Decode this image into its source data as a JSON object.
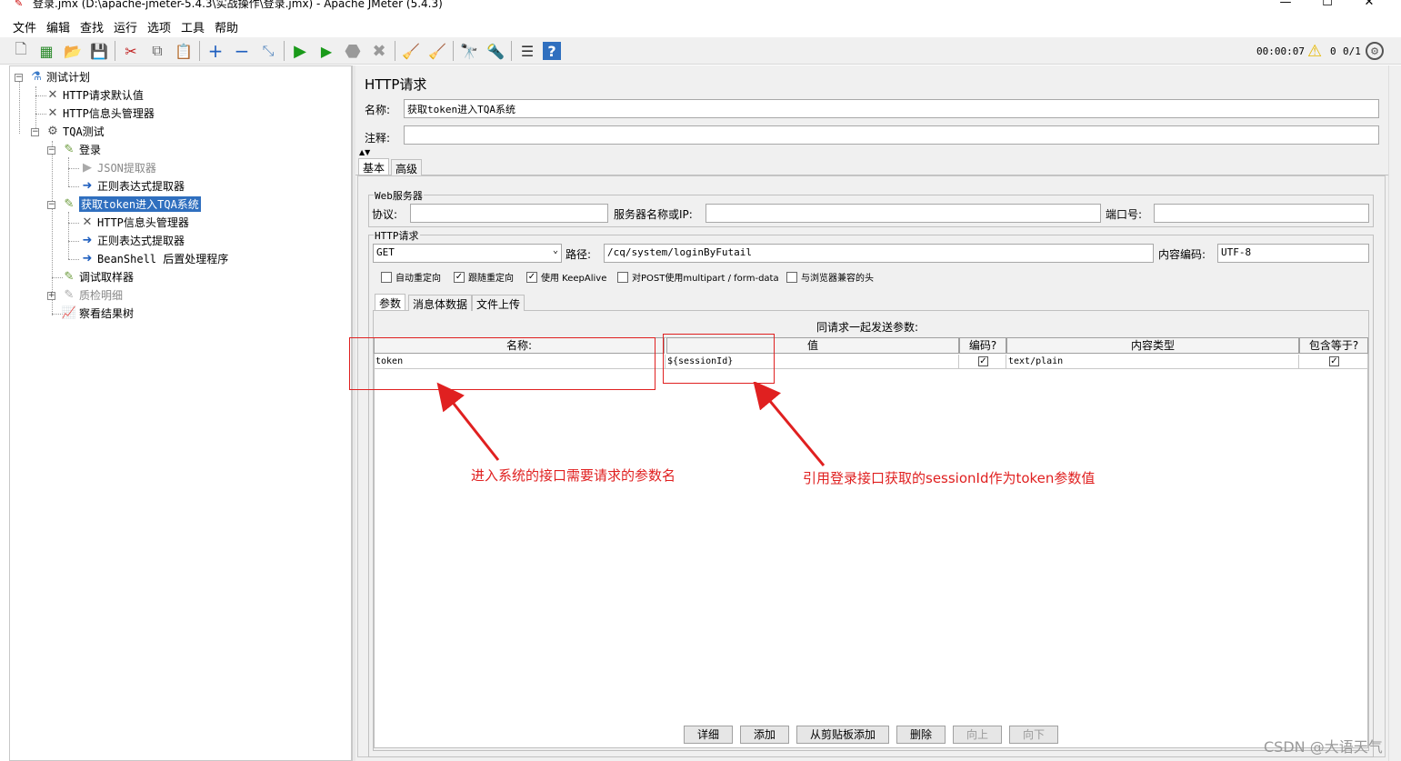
{
  "window": {
    "title": "登录.jmx (D:\\apache-jmeter-5.4.3\\实战操作\\登录.jmx) - Apache JMeter (5.4.3)",
    "minimize": "—",
    "maximize": "☐",
    "close": "✕"
  },
  "menu": [
    "文件",
    "编辑",
    "查找",
    "运行",
    "选项",
    "工具",
    "帮助"
  ],
  "toolbar": {
    "timer": "00:00:07",
    "error_count": "0",
    "threads": "0/1"
  },
  "tree": {
    "test_plan": "测试计划",
    "http_defaults": "HTTP请求默认值",
    "http_header_mgr": "HTTP信息头管理器",
    "thread_group": "TQA测试",
    "login": "登录",
    "json_extractor": "JSON提取器",
    "regex_extractor": "正则表达式提取器",
    "get_token": "获取token进入TQA系统",
    "header_mgr2": "HTTP信息头管理器",
    "regex_extractor2": "正则表达式提取器",
    "beanshell": "BeanShell 后置处理程序",
    "debug_sampler": "调试取样器",
    "quality_detail": "质检明细",
    "result_tree": "察看结果树"
  },
  "panel": {
    "title": "HTTP请求",
    "name_label": "名称:",
    "name_value": "获取token进入TQA系统",
    "comment_label": "注释:",
    "comment_value": "",
    "tabs": [
      "基本",
      "高级"
    ],
    "web_server": {
      "title": "Web服务器",
      "protocol_label": "协议:",
      "protocol_value": "",
      "server_label": "服务器名称或IP:",
      "server_value": "",
      "port_label": "端口号:",
      "port_value": ""
    },
    "http_request": {
      "title": "HTTP请求",
      "method": "GET",
      "path_label": "路径:",
      "path_value": "/cq/system/loginByFutail",
      "encoding_label": "内容编码:",
      "encoding_value": "UTF-8"
    },
    "checkboxes": [
      {
        "label": "自动重定向",
        "checked": false
      },
      {
        "label": "跟随重定向",
        "checked": true
      },
      {
        "label": "使用 KeepAlive",
        "checked": true
      },
      {
        "label": "对POST使用multipart / form-data",
        "checked": false
      },
      {
        "label": "与浏览器兼容的头",
        "checked": false
      }
    ],
    "subtabs": [
      "参数",
      "消息体数据",
      "文件上传"
    ],
    "params_title": "同请求一起发送参数:",
    "columns": [
      "名称:",
      "值",
      "编码?",
      "内容类型",
      "包含等于?"
    ],
    "rows": [
      {
        "name": "token",
        "value": "${sessionId}",
        "encode": true,
        "content_type": "text/plain",
        "include_equals": true
      }
    ],
    "buttons": [
      "详细",
      "添加",
      "从剪贴板添加",
      "删除",
      "向上",
      "向下"
    ]
  },
  "annotations": {
    "left": "进入系统的接口需要请求的参数名",
    "right": "引用登录接口获取的sessionId作为token参数值"
  },
  "watermark": "CSDN @大语天气"
}
